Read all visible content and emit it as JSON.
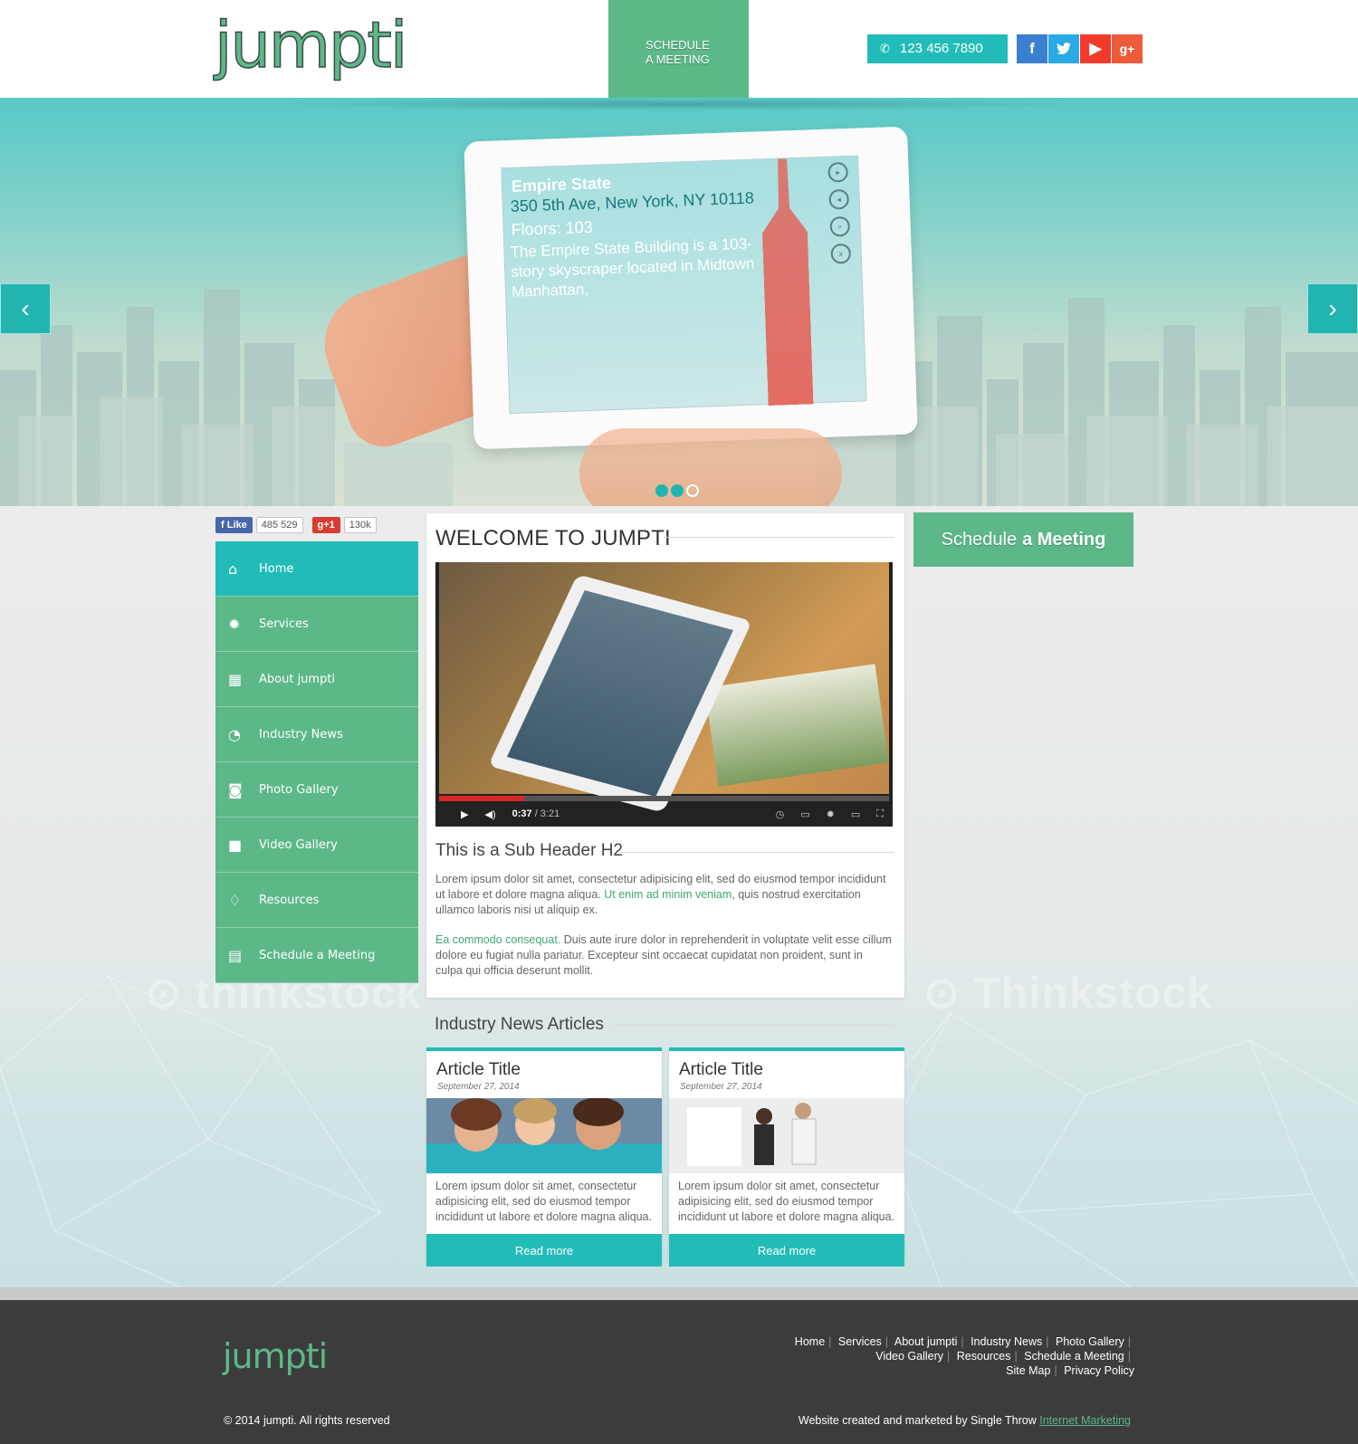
{
  "header": {
    "logo": "jumpti",
    "schedule_line1": "SCHEDULE",
    "schedule_line2": "A MEETING",
    "phone": "123 456 7890",
    "social": {
      "facebook": "f",
      "twitter": "t",
      "youtube": "▶",
      "googleplus": "g+"
    }
  },
  "hero": {
    "screen_title": "Empire State",
    "screen_address": "350 5th Ave, New York, NY 10118",
    "screen_floors": "Floors: 103",
    "screen_desc": "The Empire State Building is a 103-story skyscraper located in Midtown Manhattan,",
    "screen_controls": [
      "▸",
      "◂",
      "⌕",
      "x"
    ],
    "prev": "‹",
    "next": "›",
    "dots_active": 1
  },
  "social_counts": {
    "fb_label": "Like",
    "fb_count": "485 529",
    "gplus_label": "+1",
    "gplus_count": "130k"
  },
  "nav": {
    "items": [
      {
        "label": "Home",
        "icon": "home-icon",
        "glyph": "⌂"
      },
      {
        "label": "Services",
        "icon": "gear-icon",
        "glyph": "✹"
      },
      {
        "label": "About jumpti",
        "icon": "qrcode-icon",
        "glyph": "▦"
      },
      {
        "label": "Industry News",
        "icon": "rss-icon",
        "glyph": "◔"
      },
      {
        "label": "Photo Gallery",
        "icon": "camera-icon",
        "glyph": "◙"
      },
      {
        "label": "Video Gallery",
        "icon": "video-camera-icon",
        "glyph": "■"
      },
      {
        "label": "Resources",
        "icon": "lightbulb-icon",
        "glyph": "♢"
      },
      {
        "label": "Schedule a Meeting",
        "icon": "calendar-icon",
        "glyph": "▤"
      }
    ]
  },
  "main": {
    "title": "WELCOME TO JUMPTI",
    "video": {
      "current": "0:37",
      "total": "/ 3:21",
      "progress": 0.19
    },
    "subheader": "This is a Sub Header H2",
    "p1_a": "Lorem ipsum dolor sit amet, consectetur adipisicing elit, sed do eiusmod tempor incididunt ut labore et dolore magna aliqua. ",
    "p1_link": "Ut enim ad minim veniam",
    "p1_b": ", quis nostrud exercitation ullamco laboris nisi ut aliquip ex.",
    "p2_link": "Ea commodo consequat.",
    "p2_b": " Duis aute irure dolor in reprehenderit in voluptate velit esse cillum dolore eu fugiat nulla pariatur. Excepteur sint occaecat cupidatat non proident, sunt in culpa qui officia deserunt mollit."
  },
  "news": {
    "heading": "Industry News Articles",
    "articles": [
      {
        "title": "Article Title",
        "date": "September 27,  2014",
        "text": "Lorem ipsum dolor sit amet, consectetur adipisicing elit, sed do eiusmod tempor incididunt ut labore et dolore magna aliqua.",
        "button": "Read more"
      },
      {
        "title": "Article Title",
        "date": "September 27,  2014",
        "text": "Lorem ipsum dolor sit amet, consectetur adipisicing elit, sed do eiusmod tempor incididunt ut labore et dolore magna aliqua.",
        "button": "Read more"
      }
    ]
  },
  "cta": {
    "light": "Schedule",
    "bold": "a Meeting"
  },
  "footer": {
    "logo": "jumpti",
    "links_row1": [
      "Home",
      "Services",
      "About jumpti",
      "Industry News",
      "Photo Gallery"
    ],
    "links_row2": [
      "Video Gallery",
      "Resources",
      "Schedule a Meeting"
    ],
    "links_row3": [
      "Site Map",
      "Privacy Policy"
    ],
    "copyright": "© 2014 jumpti. All rights reserved",
    "credit_text": "Website created and marketed by Single Throw ",
    "credit_link": "Internet Marketing"
  },
  "colors": {
    "green": "#5cb889",
    "teal": "#22bcb8",
    "footer": "#3c3c3c"
  }
}
